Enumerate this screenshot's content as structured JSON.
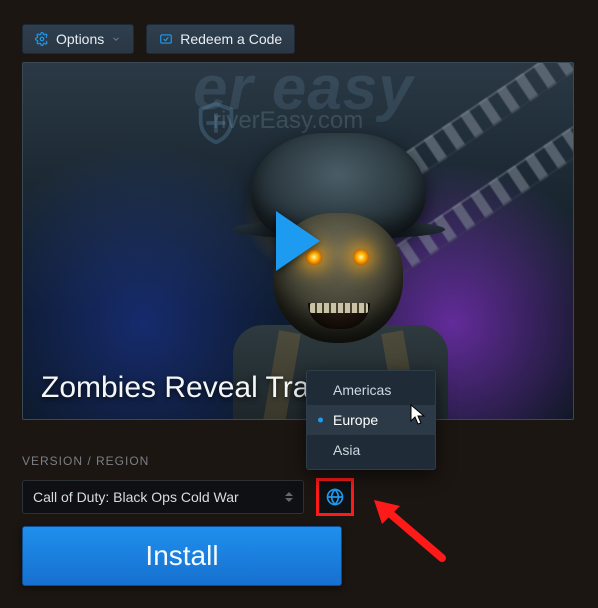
{
  "topbar": {
    "options_label": "Options",
    "redeem_label": "Redeem a Code"
  },
  "watermark": {
    "big": "er easy",
    "small": "riverEasy.com"
  },
  "card": {
    "title": "Zombies Reveal Traile"
  },
  "section_label": "VERSION / REGION",
  "version_select": {
    "value": "Call of Duty: Black Ops Cold War"
  },
  "region_menu": {
    "items": [
      "Americas",
      "Europe",
      "Asia"
    ],
    "selected": "Europe"
  },
  "install_label": "Install",
  "colors": {
    "accent_blue": "#1d9bf0",
    "highlight_red": "#ff1a1a"
  }
}
